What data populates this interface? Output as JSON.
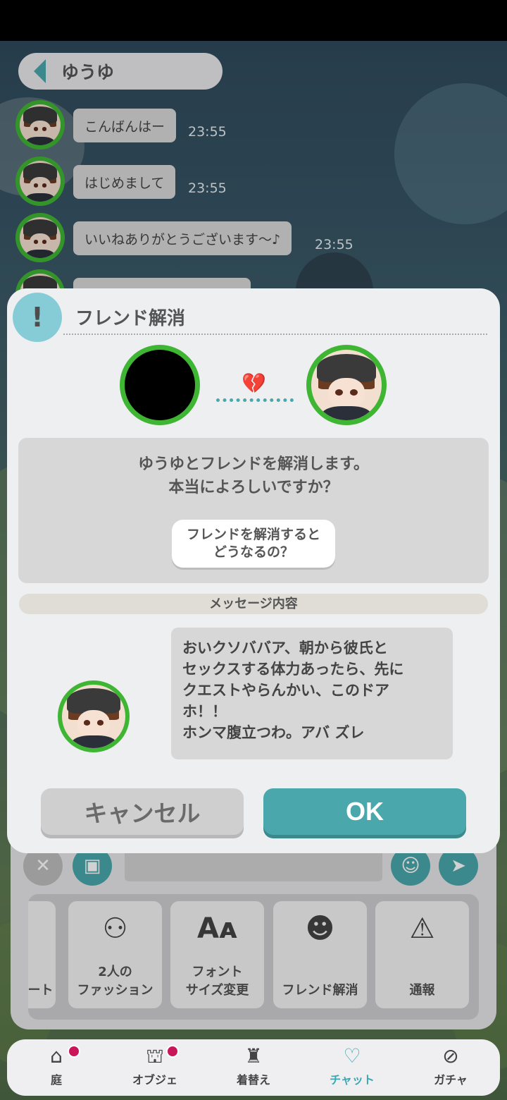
{
  "chat": {
    "title": "ゆうゆ",
    "messages": [
      {
        "text": "こんばんはー",
        "time": "23:55"
      },
      {
        "text": "はじめまして",
        "time": "23:55"
      },
      {
        "text": "いいねありがとうございます〜♪",
        "time": "23:55"
      }
    ]
  },
  "modal": {
    "title": "フレンド解消",
    "confirm_line1": "ゆうゆとフレンドを解消します。",
    "confirm_line2": "本当によろしいですか？",
    "help_line1": "フレンドを解消すると",
    "help_line2": "どうなるの？",
    "section_label": "メッセージ内容",
    "reported_message_lines": [
      "おいクソババア、朝から彼氏と",
      "セックスする体力あったら、先に",
      "クエストやらんかい、このドア",
      "ホ！！",
      "ホンマ腹立つわ。アバ ズレ"
    ],
    "cancel_label": "キャンセル",
    "ok_label": "OK"
  },
  "menu": {
    "partial_label": "ート",
    "cards": [
      {
        "line1": "2人の",
        "line2": "ファッション",
        "icon": "two-people-icon"
      },
      {
        "line1": "フォント",
        "line2": "サイズ変更",
        "icon": "font-size-icon"
      },
      {
        "line1": "フレンド解消",
        "line2": "",
        "icon": "unfriend-icon"
      },
      {
        "line1": "通報",
        "line2": "",
        "icon": "siren-icon"
      }
    ]
  },
  "nav": {
    "items": [
      {
        "label": "庭",
        "icon": "house-icon",
        "badge": true
      },
      {
        "label": "オブジェ",
        "icon": "object-icon",
        "badge": true
      },
      {
        "label": "着替え",
        "icon": "clothes-icon",
        "badge": false
      },
      {
        "label": "チャット",
        "icon": "chat-heart-icon",
        "badge": false,
        "active": true
      },
      {
        "label": "ガチャ",
        "icon": "gacha-icon",
        "badge": false
      }
    ]
  },
  "colors": {
    "accent": "#4aa8ac",
    "avatar_ring": "#3fb534",
    "badge": "#c9155a"
  }
}
